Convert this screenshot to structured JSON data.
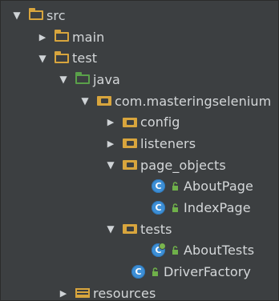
{
  "tree": {
    "rows": [
      {
        "label": "src",
        "icon": "folder-icon",
        "arrow": "expanded"
      },
      {
        "label": "main",
        "icon": "folder-icon",
        "arrow": "collapsed"
      },
      {
        "label": "test",
        "icon": "folder-icon",
        "arrow": "expanded"
      },
      {
        "label": "java",
        "icon": "source-folder-icon",
        "arrow": "expanded"
      },
      {
        "label": "com.masteringselenium",
        "icon": "package-icon",
        "arrow": "expanded"
      },
      {
        "label": "config",
        "icon": "package-icon",
        "arrow": "collapsed"
      },
      {
        "label": "listeners",
        "icon": "package-icon",
        "arrow": "collapsed"
      },
      {
        "label": "page_objects",
        "icon": "package-icon",
        "arrow": "expanded"
      },
      {
        "label": "AboutPage",
        "icon": "class-icon",
        "arrow": "none"
      },
      {
        "label": "IndexPage",
        "icon": "class-icon",
        "arrow": "none"
      },
      {
        "label": "tests",
        "icon": "package-icon",
        "arrow": "expanded"
      },
      {
        "label": "AboutTests",
        "icon": "test-class-icon",
        "arrow": "none"
      },
      {
        "label": "DriverFactory",
        "icon": "class-icon",
        "arrow": "none"
      },
      {
        "label": "resources",
        "icon": "resources-folder-icon",
        "arrow": "collapsed"
      }
    ],
    "class_letter": "C"
  },
  "colors": {
    "background": "#3c3f41",
    "folder": "#d8a53d",
    "source_folder": "#5aa04a",
    "class_icon": "#3d8fd6",
    "lock_icon": "#6fb04a",
    "text": "#d4d7d9"
  }
}
